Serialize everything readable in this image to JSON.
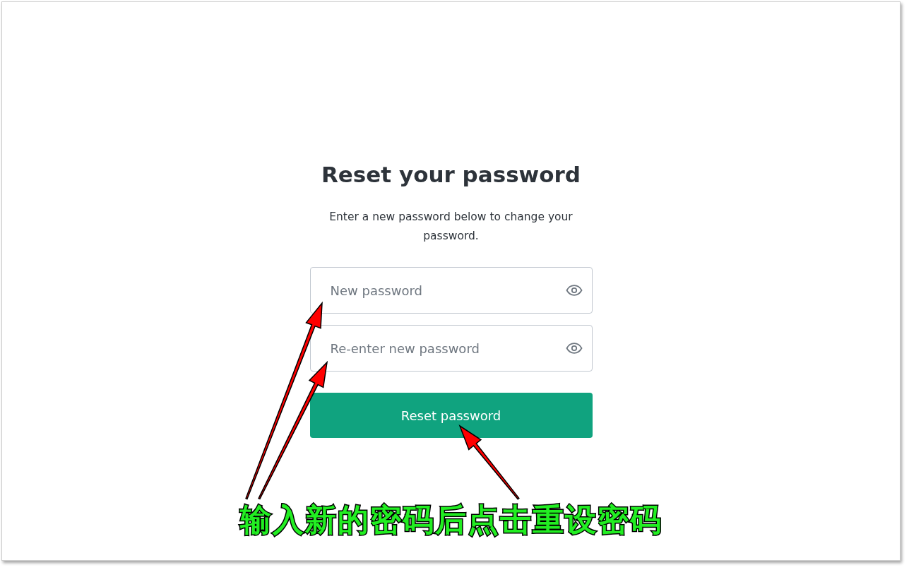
{
  "title": "Reset your password",
  "subtitle": "Enter a new password below to change your password.",
  "fields": [
    {
      "placeholder": "New password"
    },
    {
      "placeholder": "Re-enter new password"
    }
  ],
  "submit_button": "Reset password",
  "annotation": {
    "caption": "输入新的密码后点击重设密码"
  }
}
